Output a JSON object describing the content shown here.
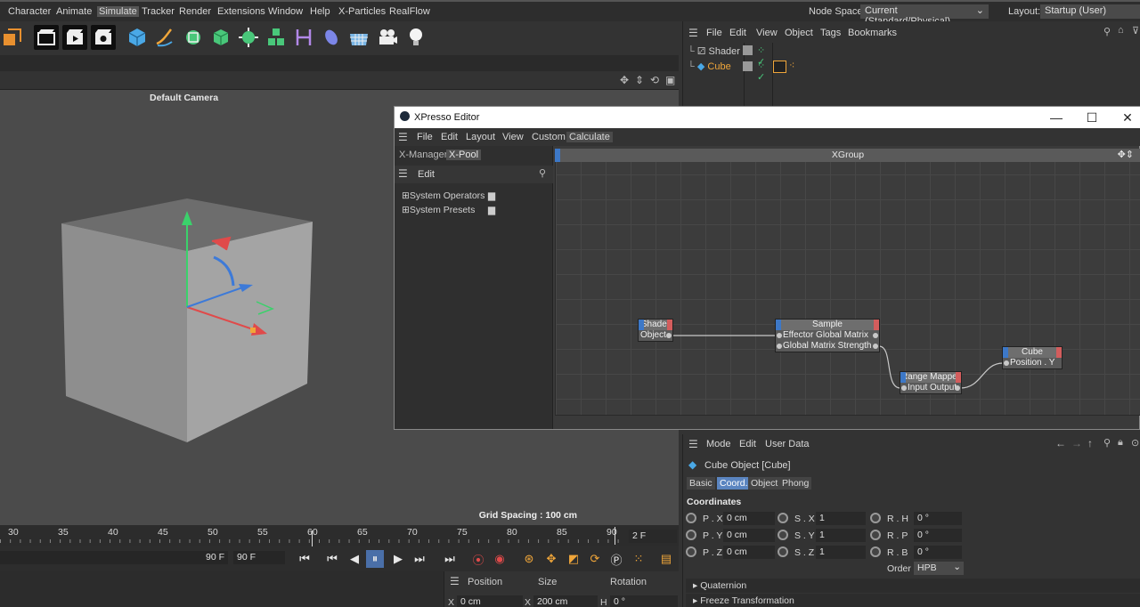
{
  "menubar": {
    "items": [
      "Character",
      "Animate",
      "Simulate",
      "Tracker",
      "Render",
      "Extensions",
      "Window",
      "Help",
      "X-Particles",
      "RealFlow"
    ],
    "node_space_label": "Node Space:",
    "node_space_value": "Current (Standard/Physical)",
    "layout_label": "Layout:",
    "layout_value": "Startup (User)"
  },
  "viewport": {
    "title": "Default Camera",
    "grid_spacing": "Grid Spacing : 100 cm"
  },
  "object_manager": {
    "menu": [
      "File",
      "Edit",
      "View",
      "Object",
      "Tags",
      "Bookmarks"
    ],
    "objects": [
      {
        "name": "Shader",
        "color": "#d0d0d0"
      },
      {
        "name": "Cube",
        "color": "#f0a63a"
      }
    ]
  },
  "xpresso": {
    "title": "XPresso Editor",
    "menu": [
      "File",
      "Edit",
      "Layout",
      "View",
      "Custom",
      "Calculate"
    ],
    "tabs": [
      "X-Manager",
      "X-Pool"
    ],
    "edit_label": "Edit",
    "tree": [
      "System Operators",
      "System Presets"
    ],
    "xgroup": "XGroup",
    "nodes": {
      "shader": {
        "title": "Shader",
        "ports": [
          "Object"
        ]
      },
      "sample": {
        "title": "Sample",
        "ports": [
          "Effector  Global Matrix",
          "Global Matrix Strength"
        ]
      },
      "range": {
        "title": "Range Mapper",
        "ports": [
          "Input  Output"
        ]
      },
      "cube": {
        "title": "Cube",
        "ports": [
          "Position . Y"
        ]
      }
    }
  },
  "attributes": {
    "menu": [
      "Mode",
      "Edit",
      "User Data"
    ],
    "object_title": "Cube Object [Cube]",
    "tabs": [
      "Basic",
      "Coord.",
      "Object",
      "Phong"
    ],
    "selected_tab": "Coord.",
    "section": "Coordinates",
    "rows": [
      {
        "p_label": "P . X",
        "p_value": "0 cm",
        "s_label": "S . X",
        "s_value": "1",
        "r_label": "R . H",
        "r_value": "0 °"
      },
      {
        "p_label": "P . Y",
        "p_value": "0 cm",
        "s_label": "S . Y",
        "s_value": "1",
        "r_label": "R . P",
        "r_value": "0 °"
      },
      {
        "p_label": "P . Z",
        "p_value": "0 cm",
        "s_label": "S . Z",
        "s_value": "1",
        "r_label": "R . B",
        "r_value": "0 °"
      }
    ],
    "order_label": "Order",
    "order_value": "HPB",
    "sections": [
      "Quaternion",
      "Freeze Transformation"
    ]
  },
  "timeline": {
    "ticks": [
      "30",
      "35",
      "40",
      "45",
      "50",
      "55",
      "60",
      "65",
      "70",
      "75",
      "80",
      "85",
      "90"
    ],
    "current_frame": "2 F",
    "end_frame": "90 F",
    "max_frame": "90 F"
  },
  "coord_manager": {
    "headers": [
      "Position",
      "Size",
      "Rotation"
    ],
    "x_label": "X",
    "pos_x": "0 cm",
    "size_x": "200 cm",
    "h_label": "H",
    "rot_h": "0 °"
  }
}
